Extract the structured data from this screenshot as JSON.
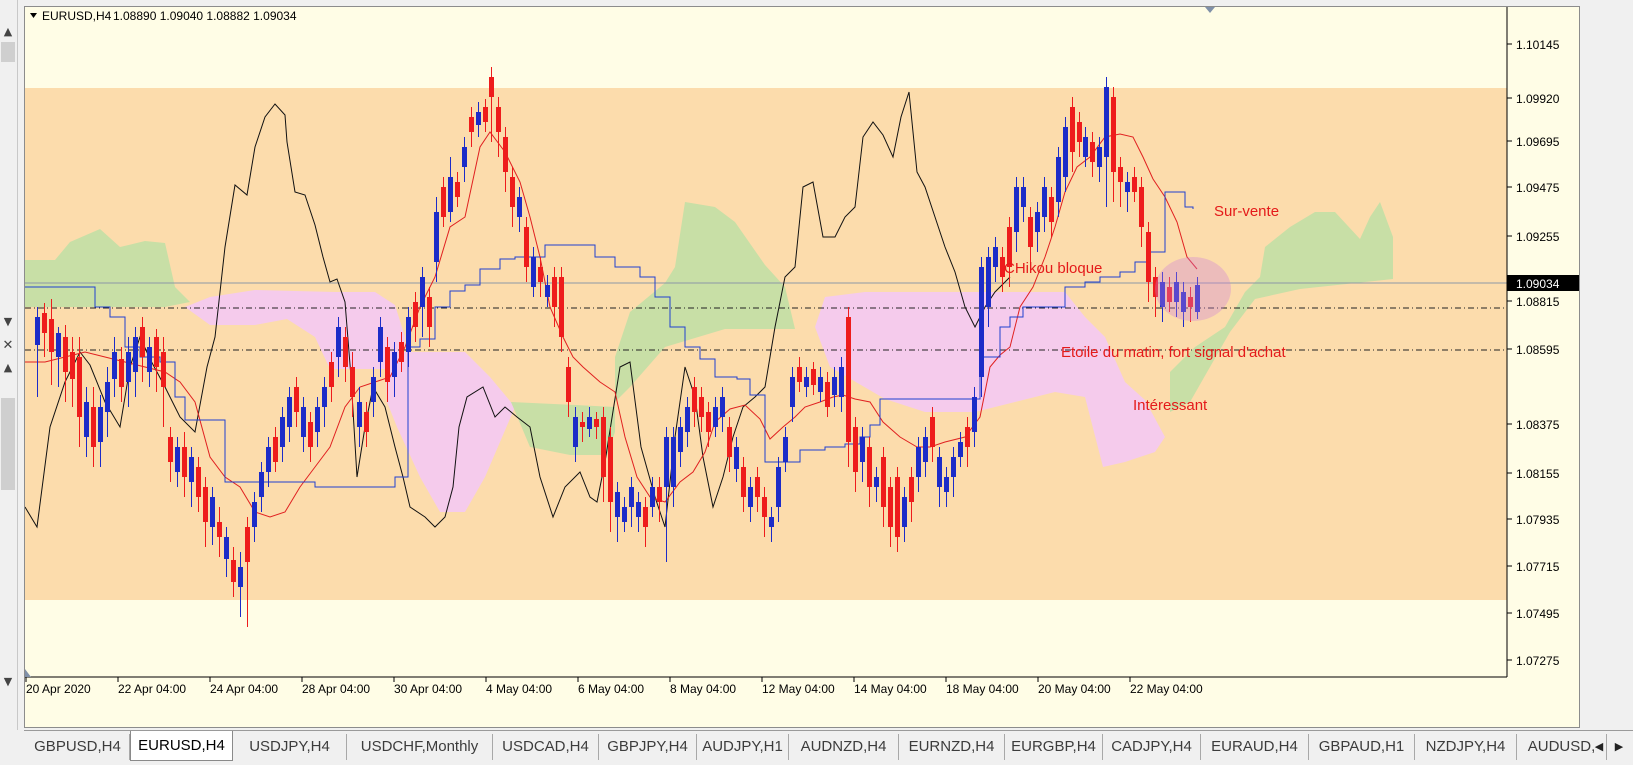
{
  "chart_header": {
    "symbol": "EURUSD,H4",
    "ohlc": "1.08890 1.09040 1.08882 1.09034"
  },
  "price_axis": {
    "labels": [
      "1.10145",
      "1.09920",
      "1.09695",
      "1.09475",
      "1.09255",
      "1.08815",
      "1.08595",
      "1.08375",
      "1.08155",
      "1.07935",
      "1.07715",
      "1.07495",
      "1.07275"
    ],
    "current_price": "1.09034"
  },
  "time_axis": {
    "labels": [
      "20 Apr 2020",
      "22 Apr 04:00",
      "24 Apr 04:00",
      "28 Apr 04:00",
      "30 Apr 04:00",
      "4 May 04:00",
      "6 May 04:00",
      "8 May 04:00",
      "12 May 04:00",
      "14 May 04:00",
      "18 May 04:00",
      "20 May 04:00",
      "22 May 04:00"
    ]
  },
  "annotations": {
    "sur_vente": "Sur-vente",
    "chikou": "CHikou bloque",
    "etoile": "Etoile du matin, fort signal d'achat",
    "interessant": "Intéressant"
  },
  "tabs": [
    "GBPUSD,H4",
    "EURUSD,H4",
    "USDJPY,H4",
    "USDCHF,Monthly",
    "USDCAD,H4",
    "GBPJPY,H4",
    "AUDJPY,H1",
    "AUDNZD,H4",
    "EURNZD,H4",
    "EURGBP,H4",
    "CADJPY,H4",
    "EURAUD,H4",
    "GBPAUD,H1",
    "NZDJPY,H4",
    "AUDUSD,"
  ],
  "active_tab": "EURUSD,H4",
  "colors": {
    "chart_bg": "#fffde6",
    "zone": "#fcdcac",
    "cloud_bull": "#c8dfa6",
    "cloud_bear": "#f5cbec",
    "candle_bull": "#1c2cc8",
    "candle_bear": "#ee1c1c",
    "tenkan": "#e02020",
    "kijun": "#2040d0",
    "chikou": "#111111",
    "annotation": "#e41a1a"
  },
  "icons": {
    "symbol_menu": "triangle-down-icon",
    "scroll_up": "chevron-up-icon",
    "scroll_down": "chevron-down-icon",
    "close": "close-icon",
    "tab_prev": "triangle-left-icon",
    "tab_next": "triangle-right-icon"
  }
}
